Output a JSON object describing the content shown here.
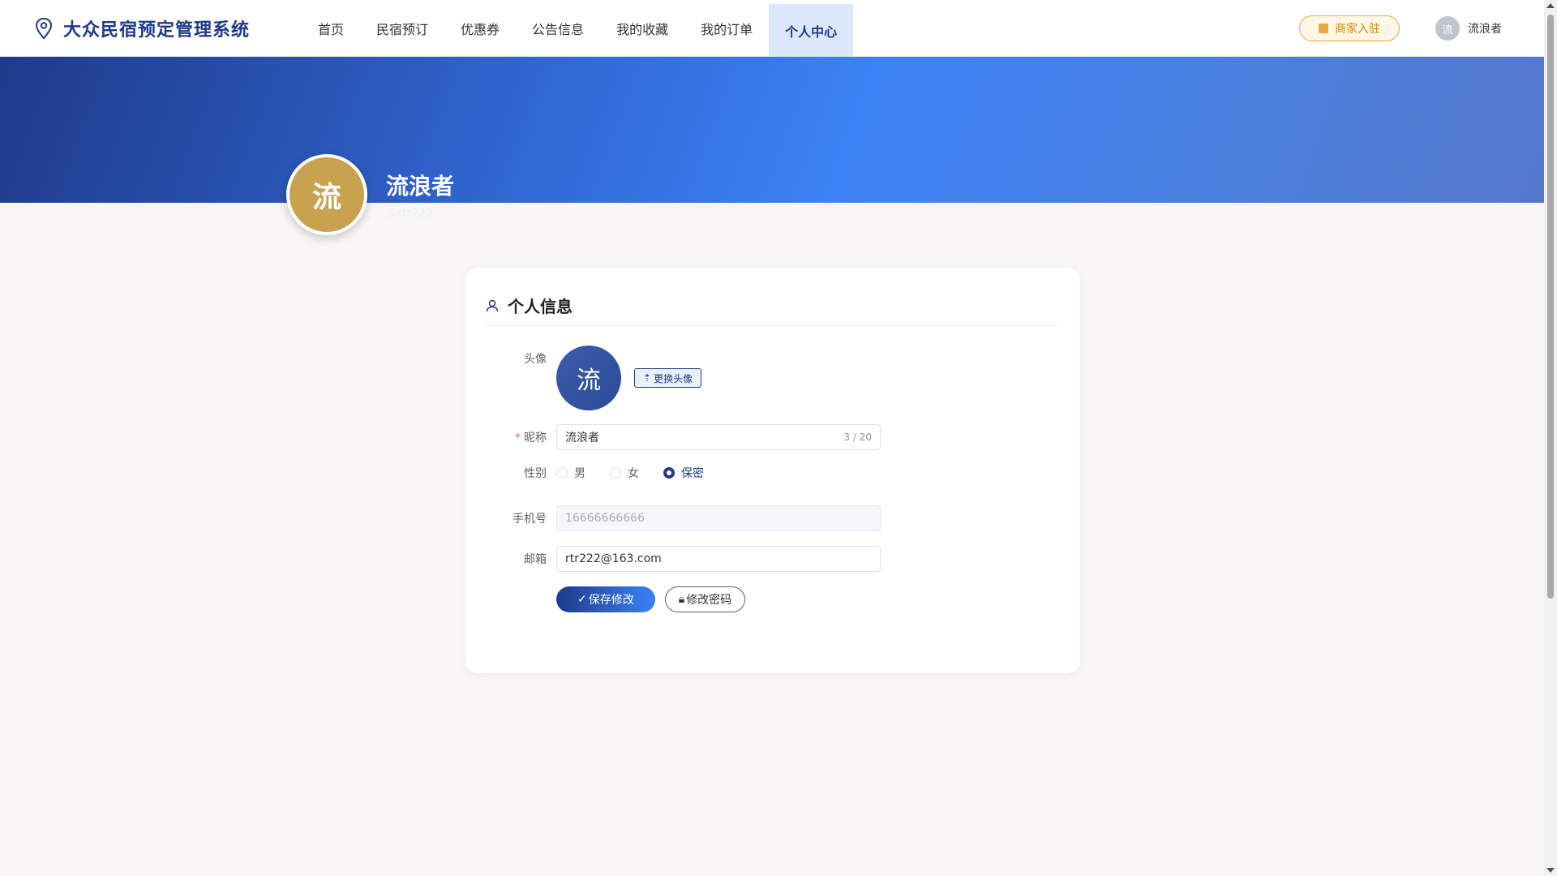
{
  "app": {
    "title": "大众民宿预定管理系统"
  },
  "nav": {
    "items": [
      {
        "label": "首页"
      },
      {
        "label": "民宿预订"
      },
      {
        "label": "优惠券"
      },
      {
        "label": "公告信息"
      },
      {
        "label": "我的收藏"
      },
      {
        "label": "我的订单"
      },
      {
        "label": "个人中心",
        "active": true
      }
    ]
  },
  "header": {
    "merchant_label": "商家入驻",
    "user_avatar_text": "流",
    "user_name": "流浪者"
  },
  "profile": {
    "avatar_text": "流",
    "name": "流浪者",
    "username": "@rtr222"
  },
  "card": {
    "title": "个人信息",
    "avatar_label": "头像",
    "avatar_text": "流",
    "change_avatar_label": "更换头像",
    "nickname_label": "昵称",
    "nickname_value": "流浪者",
    "nickname_count": "3 / 20",
    "gender_label": "性别",
    "gender_options": [
      "男",
      "女",
      "保密"
    ],
    "gender_selected": "保密",
    "phone_label": "手机号",
    "phone_value": "16666666666",
    "email_label": "邮箱",
    "email_value": "rtr222@163.com",
    "save_label": "保存修改",
    "change_password_label": "修改密码"
  },
  "colors": {
    "primary": "#1e3a8a",
    "accent": "#3b82f6",
    "gold": "#c9a24f",
    "merchant": "#e9a93a"
  }
}
